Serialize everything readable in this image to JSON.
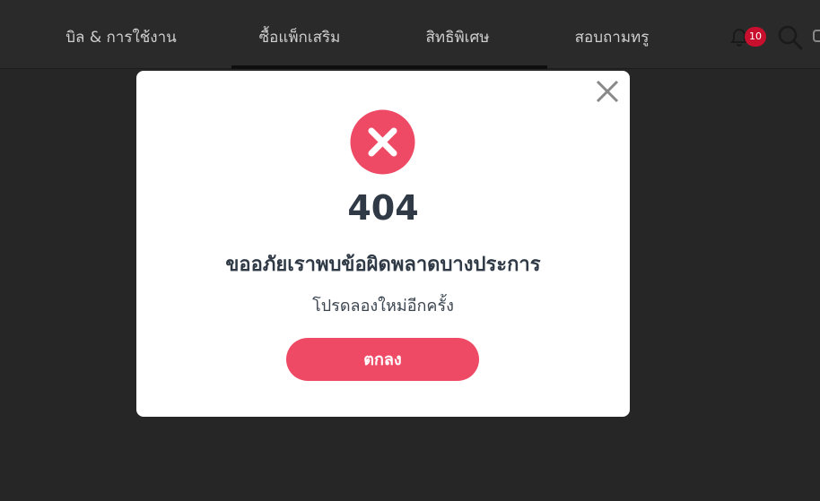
{
  "nav": {
    "items": [
      {
        "label": "บิล & การใช้งาน"
      },
      {
        "label": "ซื้อแพ็กเสริม"
      },
      {
        "label": "สิทธิพิเศษ"
      },
      {
        "label": "สอบถามทรู"
      }
    ],
    "notification_count": "10",
    "icons": [
      "bell-icon",
      "search-icon"
    ]
  },
  "modal": {
    "icon": "error-x-icon",
    "code": "404",
    "title": "ขออภัยเราพบข้อผิดพลาดบางประการ",
    "message": "โปรดลองใหม่อีกครั้ง",
    "ok_label": "ตกลง",
    "close_icon": "close-icon"
  },
  "colors": {
    "accent": "#ef4a65",
    "background": "#262626",
    "text": "#2f3a46",
    "badge": "#c8102e"
  }
}
